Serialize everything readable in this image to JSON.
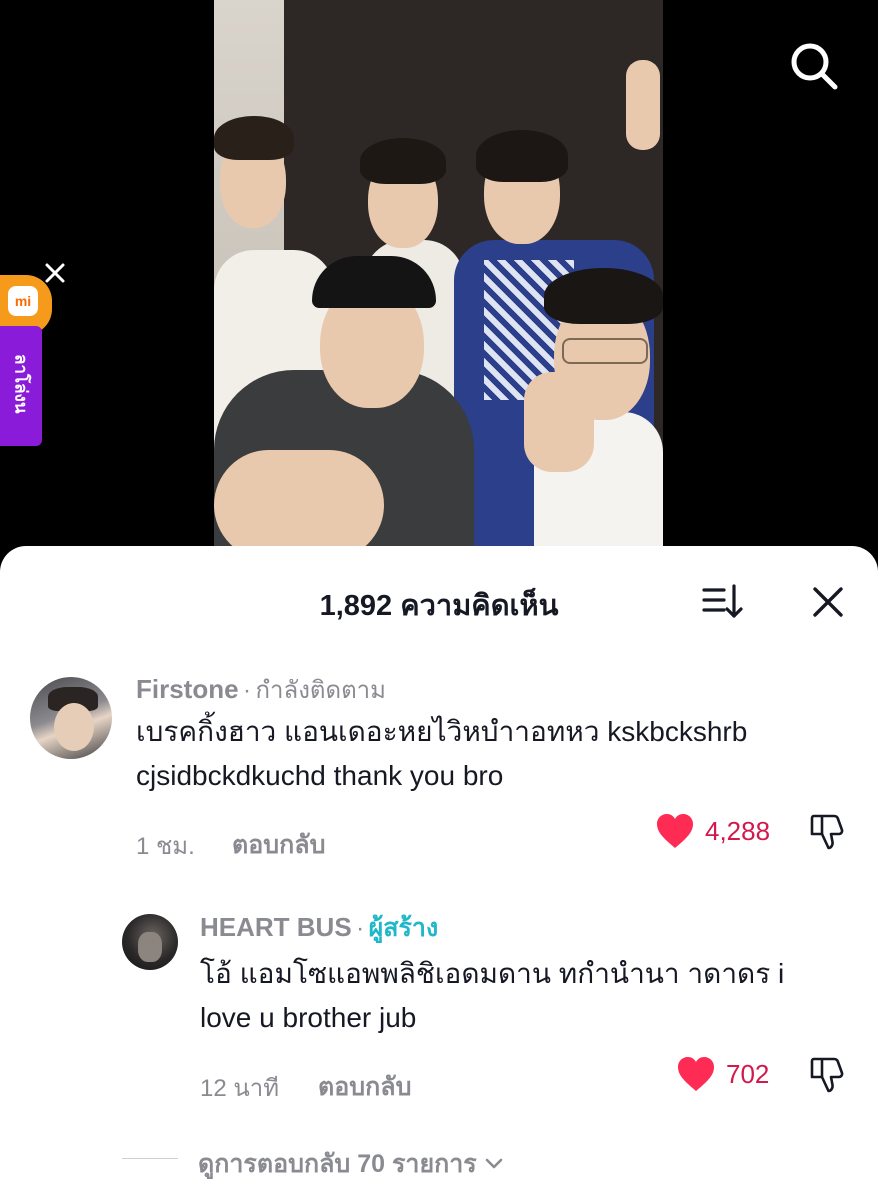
{
  "video": {
    "search_icon": "search-icon"
  },
  "promo": {
    "logo_text": "mi",
    "label": "ลาโล่งน",
    "close_icon": "close-icon"
  },
  "sheet": {
    "count_label": "1,892 ความคิดเห็น",
    "sort_icon": "sort-icon",
    "close_icon": "close-icon"
  },
  "comments": [
    {
      "username": "Firstone",
      "separator": "·",
      "tag": "กำลังติดตาม",
      "text_line1": "เบรคกิ้งฮาว แอนเดอะหยไวิหบำาอทหว kskbckshrb",
      "text_line2": "cjsidbckdkuchd thank you bro",
      "time": "1 ชม.",
      "reply_label": "ตอบกลับ",
      "likes": "4,288"
    }
  ],
  "replies": [
    {
      "username": "HEART BUS",
      "separator": "·",
      "tag": "ผู้สร้าง",
      "text_line1": "โอ้ แอมโซแอพพลิชิเอดมดาน ทกำนำนา าดาดร i",
      "text_line2": "love u brother jub",
      "time": "12 นาที",
      "reply_label": "ตอบกลับ",
      "likes": "702"
    }
  ],
  "view_replies": {
    "label": "ดูการตอบกลับ 70 รายการ"
  },
  "colors": {
    "like": "#fe2c55",
    "creator": "#20b8c8",
    "promo": "#8a1bd8"
  }
}
